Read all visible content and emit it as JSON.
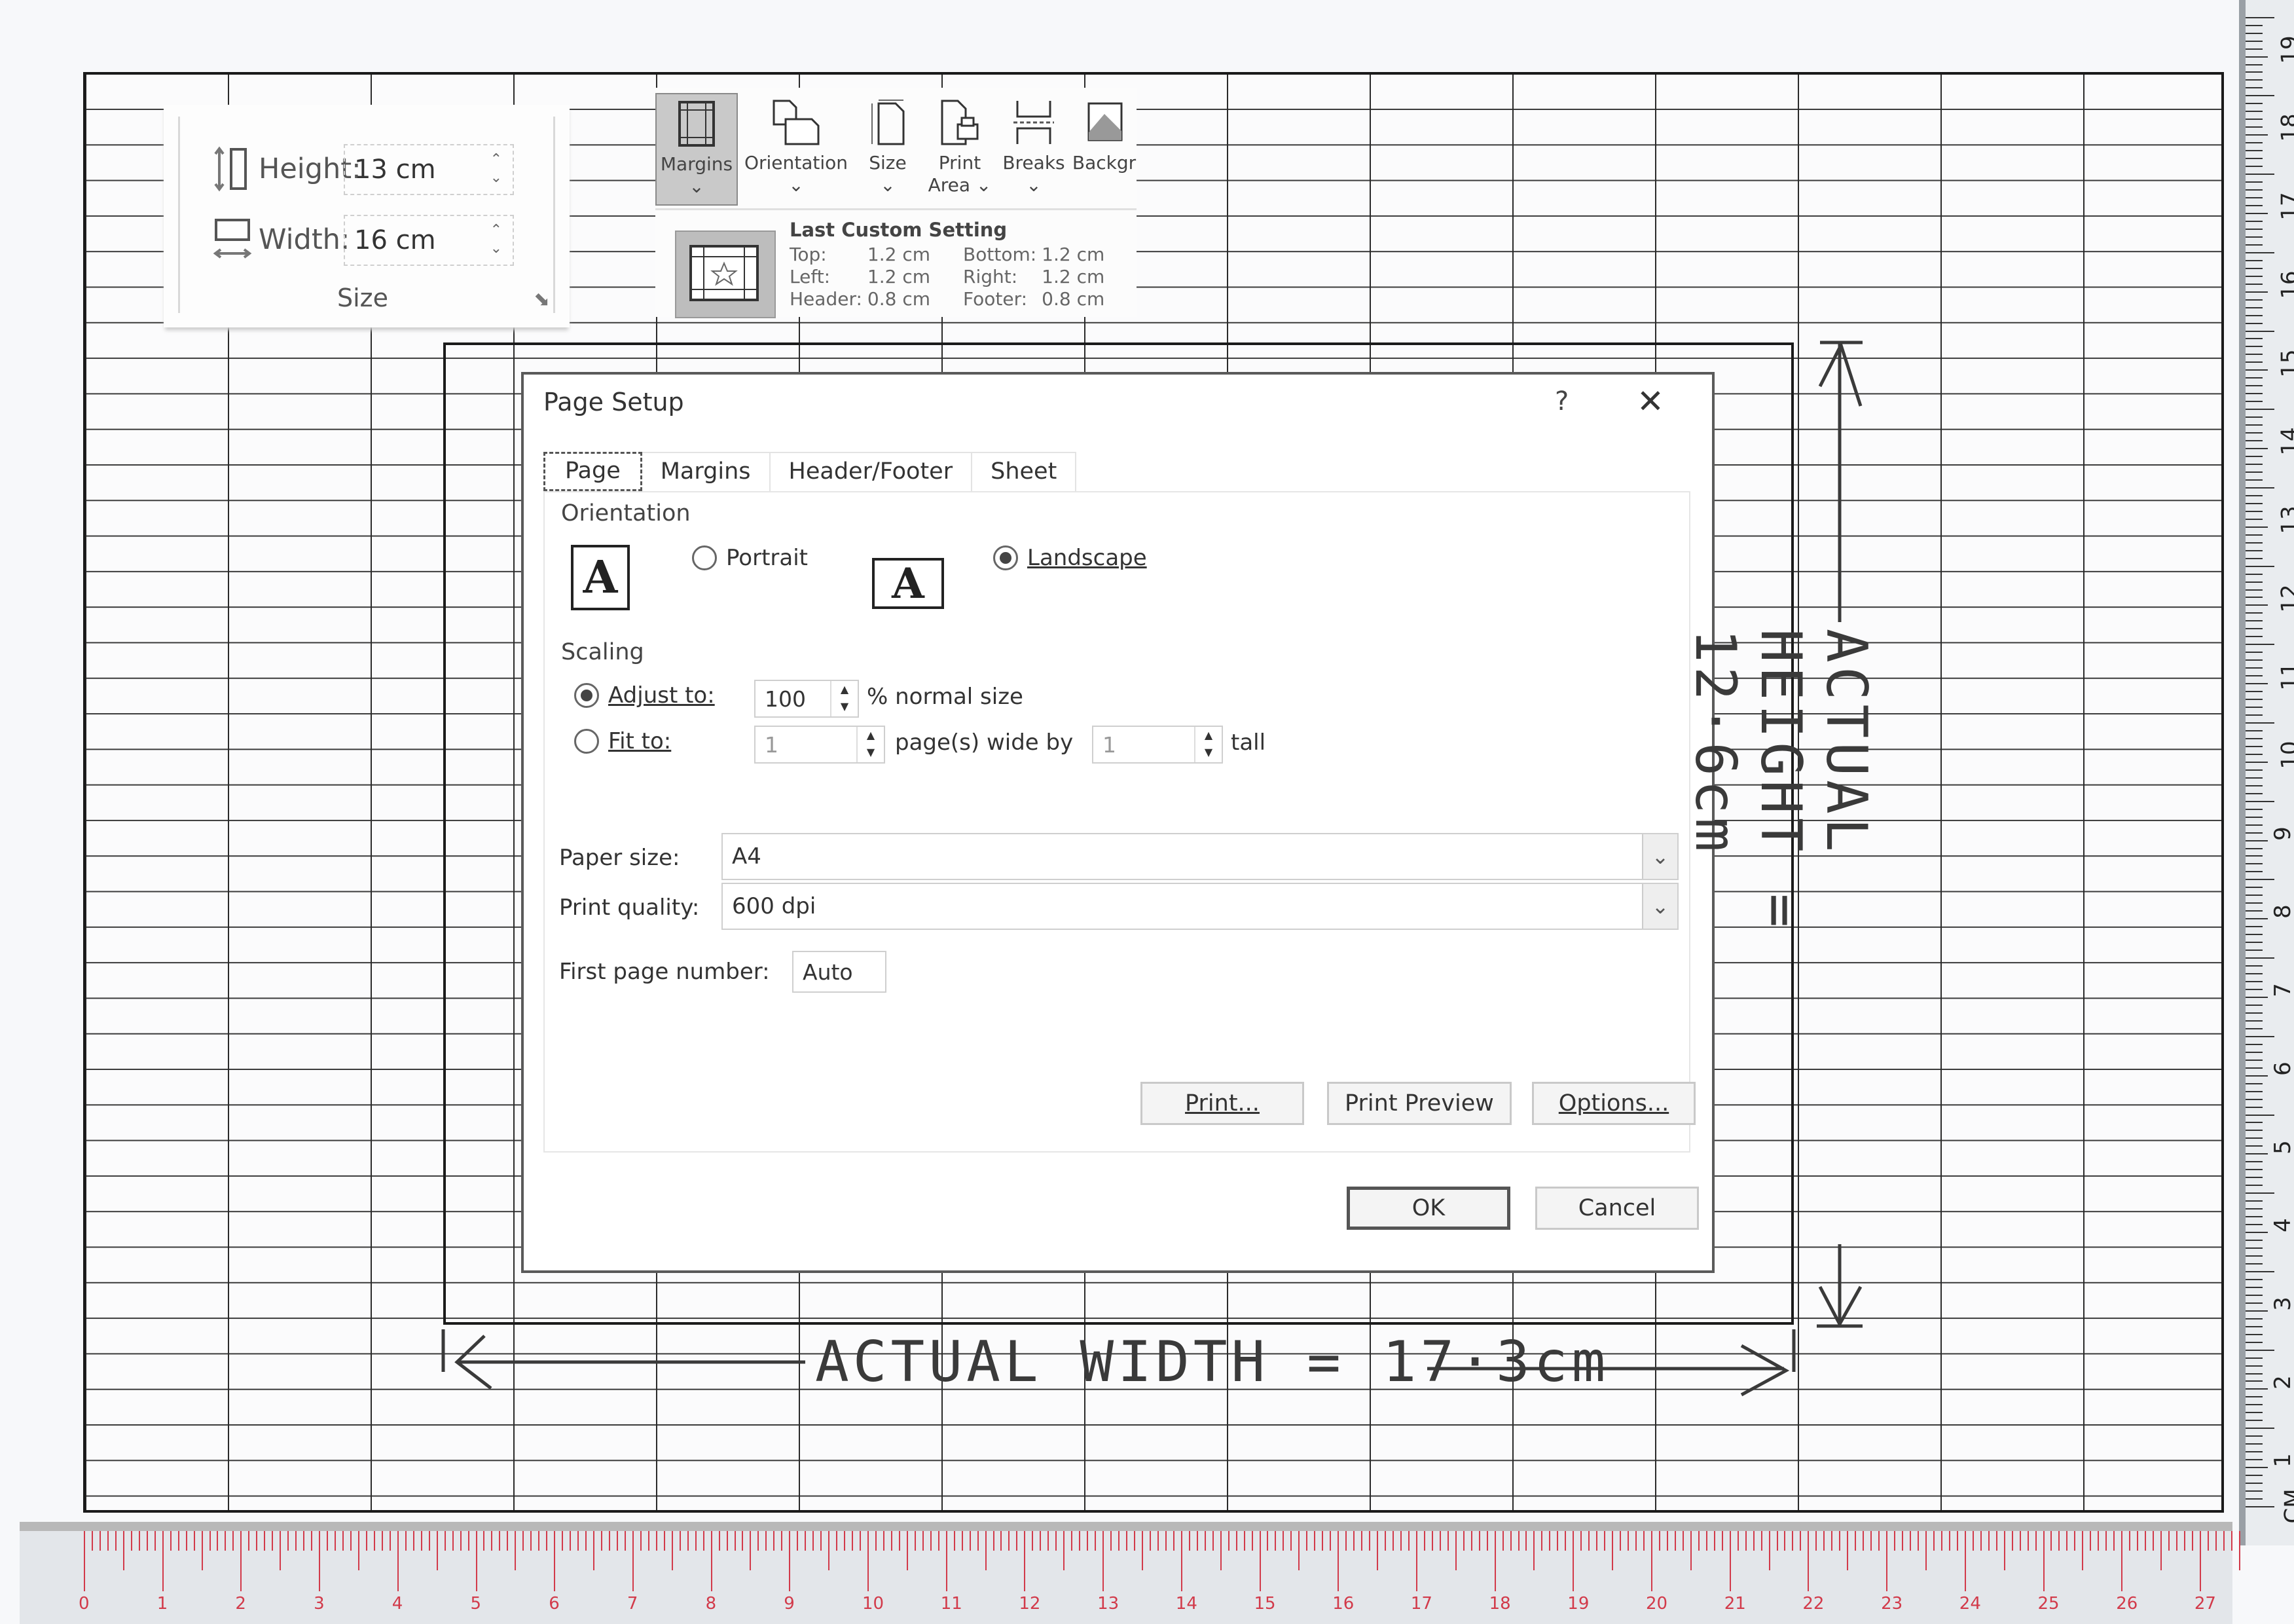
{
  "size_group": {
    "height_label": "Height:",
    "height_value": "13 cm",
    "width_label": "Width:",
    "width_value": "16 cm",
    "caption": "Size"
  },
  "ribbon": {
    "buttons": [
      {
        "label": "Margins",
        "sub": "⌄",
        "icon": "margins-icon",
        "active": true
      },
      {
        "label": "Orientation",
        "sub": "⌄",
        "icon": "orientation-icon"
      },
      {
        "label": "Size",
        "sub": "⌄",
        "icon": "size-icon"
      },
      {
        "label": "Print",
        "sub": "Area ⌄",
        "icon": "print-area-icon"
      },
      {
        "label": "Breaks",
        "sub": "⌄",
        "icon": "breaks-icon"
      },
      {
        "label": "Backgr",
        "sub": "",
        "icon": "background-icon"
      }
    ],
    "last_custom": {
      "title": "Last Custom Setting",
      "top_label": "Top:",
      "top_value": "1.2 cm",
      "bottom_label": "Bottom:",
      "bottom_value": "1.2 cm",
      "left_label": "Left:",
      "left_value": "1.2 cm",
      "right_label": "Right:",
      "right_value": "1.2 cm",
      "header_label": "Header:",
      "header_value": "0.8 cm",
      "footer_label": "Footer:",
      "footer_value": "0.8 cm"
    }
  },
  "dialog": {
    "title": "Page Setup",
    "help": "?",
    "close": "✕",
    "tabs": [
      "Page",
      "Margins",
      "Header/Footer",
      "Sheet"
    ],
    "active_tab": "Page",
    "orientation": {
      "heading": "Orientation",
      "portrait_label": "Portrait",
      "landscape_label": "Landscape",
      "selected": "Landscape",
      "icon_glyph": "A"
    },
    "scaling": {
      "heading": "Scaling",
      "adjust_label": "Adjust to:",
      "adjust_value": "100",
      "adjust_suffix": "% normal size",
      "fit_label": "Fit to:",
      "fit_wide_value": "1",
      "fit_wide_suffix": "page(s) wide by",
      "fit_tall_value": "1",
      "fit_tall_suffix": "tall",
      "selected": "Adjust to"
    },
    "paper_size_label": "Paper size:",
    "paper_size_value": "A4",
    "print_quality_label": "Print quality:",
    "print_quality_value": "600 dpi",
    "first_page_label": "First page number:",
    "first_page_value": "Auto",
    "buttons": {
      "print": "Print...",
      "print_preview": "Print Preview",
      "options": "Options...",
      "ok": "OK",
      "cancel": "Cancel"
    }
  },
  "annotations": {
    "width_note": "ACTUAL WIDTH = 17·3cm",
    "height_note": "ACTUAL HEIGHT = 12·6cm"
  },
  "rulers": {
    "right_unit": "CM",
    "right_labels": [
      "1",
      "2",
      "3",
      "4",
      "5",
      "6",
      "7",
      "8",
      "9",
      "10",
      "11",
      "12",
      "13",
      "14",
      "15",
      "16",
      "17",
      "18",
      "19"
    ],
    "bottom_labels": [
      "0",
      "1",
      "2",
      "3",
      "4",
      "5",
      "6",
      "7",
      "8",
      "9",
      "10",
      "11",
      "12",
      "13",
      "14",
      "15",
      "16",
      "17",
      "18",
      "19",
      "20",
      "21",
      "22",
      "23",
      "24",
      "25",
      "26",
      "27"
    ],
    "bottom_color": "#d23a4a"
  }
}
